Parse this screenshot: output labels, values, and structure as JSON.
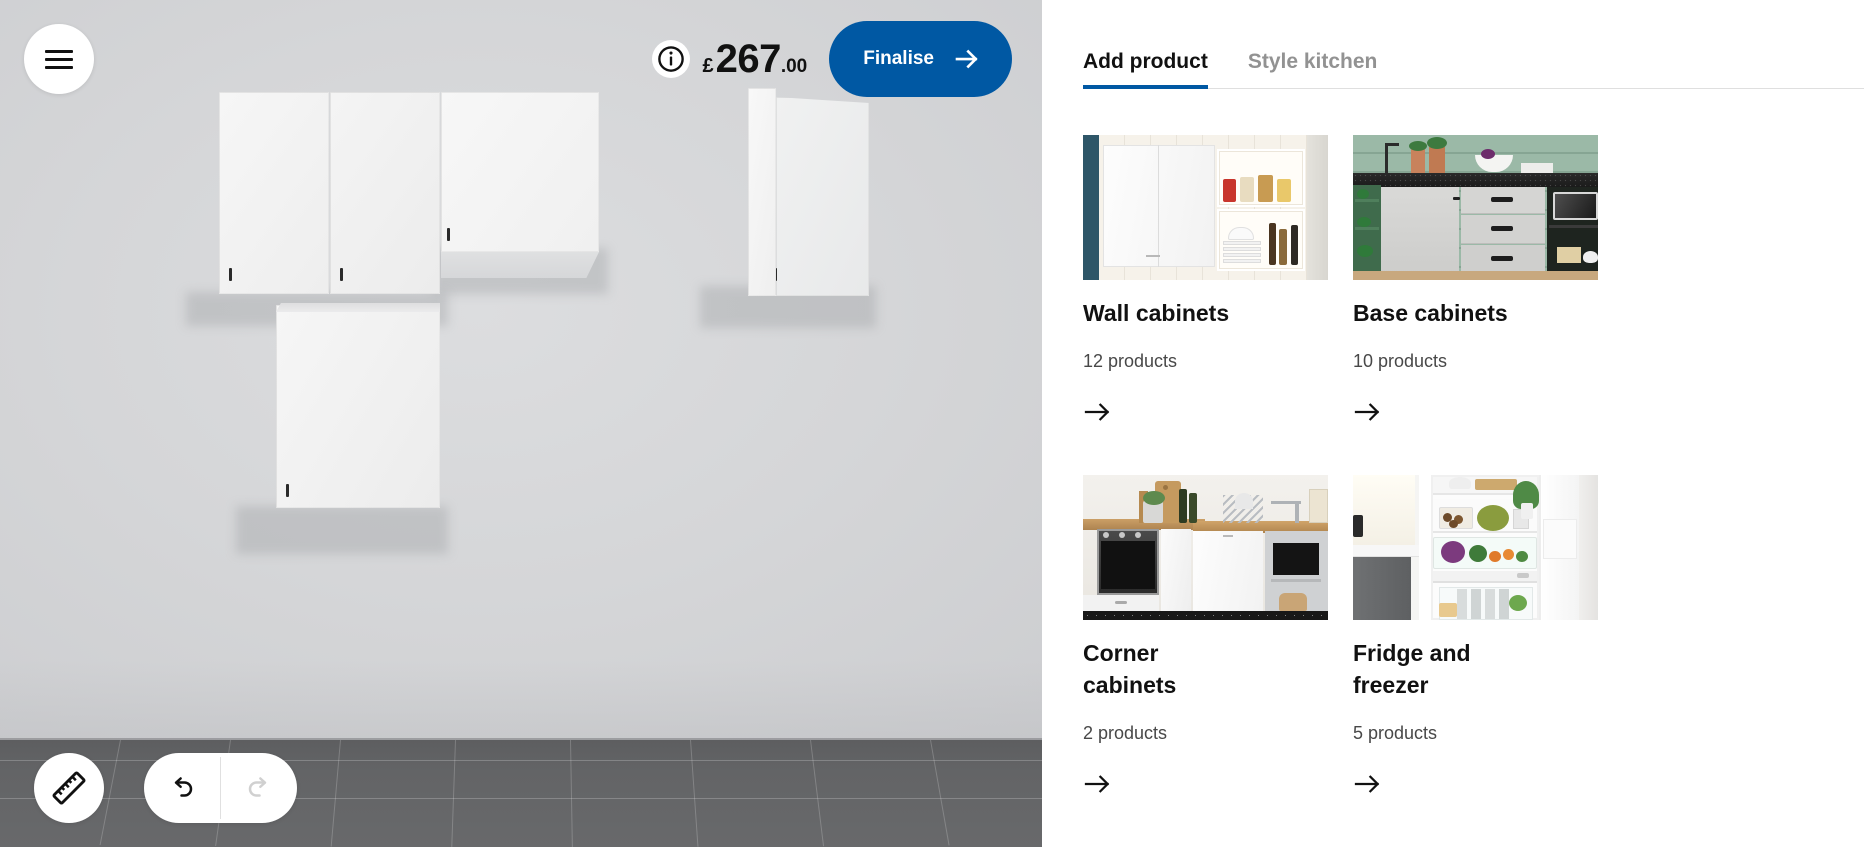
{
  "viewport": {
    "menu_button": "menu",
    "info_icon": "info-icon",
    "price": {
      "currency": "£",
      "amount": "267",
      "decimals": ".00"
    },
    "finalise_label": "Finalise",
    "finalise_arrow": "arrow-right-icon",
    "measure_icon": "ruler-icon",
    "undo_icon": "undo-icon",
    "redo_icon": "redo-icon",
    "colors": {
      "accent_blue": "#0058a3",
      "wall": "#d6d7d9",
      "floor": "#636466",
      "cabinet": "#f3f3f3"
    }
  },
  "panel": {
    "tabs": [
      {
        "label": "Add product",
        "active": true
      },
      {
        "label": "Style kitchen",
        "active": false
      }
    ],
    "cards": [
      {
        "title": "Wall cabinets",
        "count": "12 products",
        "thumb": "wall-cabinets-photo",
        "arrow": "arrow-right-icon"
      },
      {
        "title": "Base cabinets",
        "count": "10 products",
        "thumb": "base-cabinets-photo",
        "arrow": "arrow-right-icon"
      },
      {
        "title": "Corner cabinets",
        "count": "2 products",
        "thumb": "corner-cabinets-photo",
        "arrow": "arrow-right-icon"
      },
      {
        "title": "Fridge and freezer",
        "count": "5 products",
        "thumb": "fridge-freezer-photo",
        "arrow": "arrow-right-icon"
      }
    ]
  }
}
